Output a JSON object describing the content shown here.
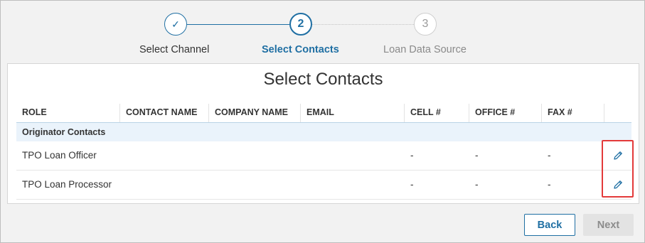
{
  "stepper": {
    "steps": [
      {
        "number": "✓",
        "label": "Select Channel",
        "state": "done"
      },
      {
        "number": "2",
        "label": "Select Contacts",
        "state": "active"
      },
      {
        "number": "3",
        "label": "Loan Data Source",
        "state": "todo"
      }
    ]
  },
  "panel": {
    "title": "Select Contacts",
    "columns": [
      "ROLE",
      "CONTACT NAME",
      "COMPANY NAME",
      "EMAIL",
      "CELL #",
      "OFFICE #",
      "FAX #"
    ],
    "group_label": "Originator Contacts",
    "rows": [
      {
        "role": "TPO Loan Officer",
        "contact_name": "",
        "company_name": "",
        "email": "",
        "cell": "-",
        "office": "-",
        "fax": "-"
      },
      {
        "role": "TPO Loan Processor",
        "contact_name": "",
        "company_name": "",
        "email": "",
        "cell": "-",
        "office": "-",
        "fax": "-"
      }
    ],
    "edit_icon": "pencil-icon"
  },
  "footer": {
    "back_label": "Back",
    "next_label": "Next"
  },
  "colors": {
    "accent": "#1f6fa3",
    "highlight": "#e33a3a",
    "group_bg": "#eaf3fb"
  }
}
